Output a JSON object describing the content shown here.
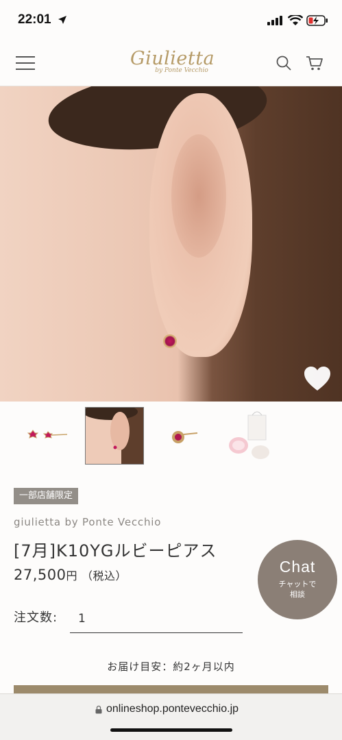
{
  "status_bar": {
    "time": "22:01",
    "icons": [
      "location-arrow-icon",
      "signal-icon",
      "wifi-icon",
      "battery-charging-icon"
    ]
  },
  "header": {
    "logo_main": "Giulietta",
    "logo_sub": "by Ponte Vecchio",
    "icons": [
      "menu-icon",
      "search-icon",
      "cart-icon"
    ]
  },
  "gallery": {
    "favorite_icon": "heart-icon",
    "thumbnail_count": 4,
    "selected_thumbnail_index": 1
  },
  "product": {
    "badge": "一部店舗限定",
    "brand": "giulietta by Ponte Vecchio",
    "title": "[7月]K10YGルビーピアス",
    "price": "27,500",
    "price_unit": "円",
    "price_tax": "（税込）",
    "quantity_label": "注文数:",
    "quantity_value": "1",
    "delivery": "お届け目安：約2ヶ月以内"
  },
  "chat": {
    "title": "Chat",
    "subtitle": "チャットで相談"
  },
  "browser": {
    "url": "onlineshop.pontevecchio.jp"
  },
  "colors": {
    "brand_gold": "#b59a66",
    "badge_bg": "#938e88",
    "chat_bg": "#8b7f76",
    "cart_button": "#9c8a6b"
  }
}
